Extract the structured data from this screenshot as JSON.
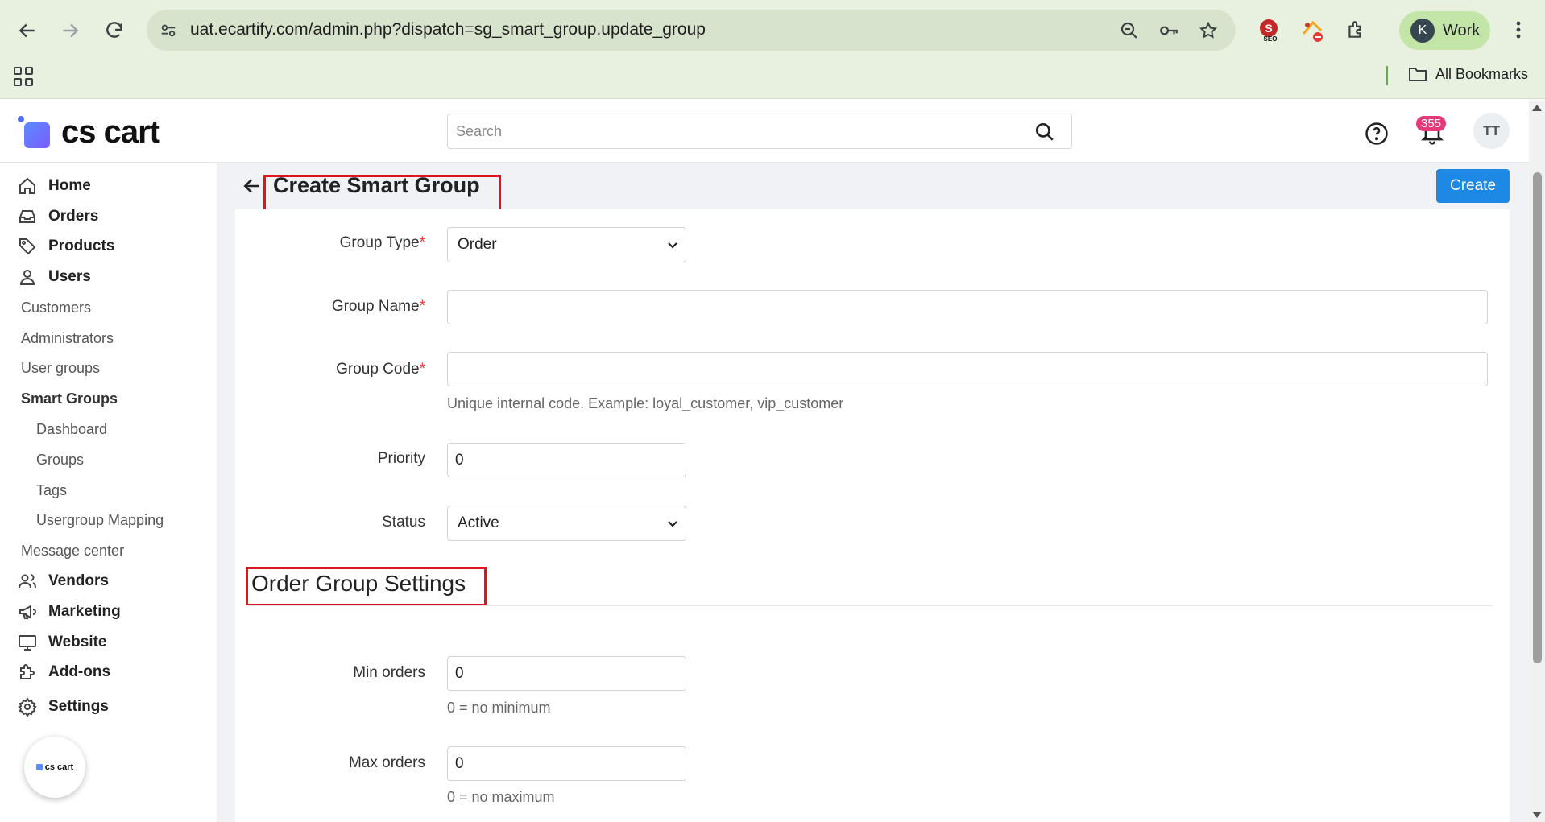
{
  "browser": {
    "url": "uat.ecartify.com/admin.php?dispatch=sg_smart_group.update_group",
    "profile_initial": "K",
    "profile_label": "Work",
    "bookmarks_label": "All Bookmarks",
    "seo_ext_label": "SEO"
  },
  "header": {
    "logo_text": "cs cart",
    "search_placeholder": "Search",
    "notification_count": "355",
    "avatar_initials": "TT"
  },
  "sidebar": {
    "items": [
      {
        "label": "Home"
      },
      {
        "label": "Orders"
      },
      {
        "label": "Products"
      },
      {
        "label": "Users"
      },
      {
        "label": "Customers"
      },
      {
        "label": "Administrators"
      },
      {
        "label": "User groups"
      },
      {
        "label": "Smart Groups"
      },
      {
        "label": "Dashboard"
      },
      {
        "label": "Groups"
      },
      {
        "label": "Tags"
      },
      {
        "label": "Usergroup Mapping"
      },
      {
        "label": "Message center"
      },
      {
        "label": "Vendors"
      },
      {
        "label": "Marketing"
      },
      {
        "label": "Website"
      },
      {
        "label": "Add-ons"
      },
      {
        "label": "Settings"
      }
    ],
    "float_logo_text": "cs cart"
  },
  "page": {
    "title": "Create Smart Group",
    "create_label": "Create"
  },
  "form": {
    "group_type": {
      "label": "Group Type",
      "required": "*",
      "value": "Order"
    },
    "group_name": {
      "label": "Group Name",
      "required": "*",
      "value": ""
    },
    "group_code": {
      "label": "Group Code",
      "required": "*",
      "value": "",
      "help": "Unique internal code. Example: loyal_customer, vip_customer"
    },
    "priority": {
      "label": "Priority",
      "value": "0"
    },
    "status": {
      "label": "Status",
      "value": "Active"
    }
  },
  "order_settings": {
    "title": "Order Group Settings",
    "min_orders": {
      "label": "Min orders",
      "value": "0",
      "help": "0 = no minimum"
    },
    "max_orders": {
      "label": "Max orders",
      "value": "0",
      "help": "0 = no maximum"
    }
  },
  "colors": {
    "primary": "#1e88e5",
    "highlight": "#e0141e",
    "badge": "#e6397a",
    "required": "#e53935"
  }
}
